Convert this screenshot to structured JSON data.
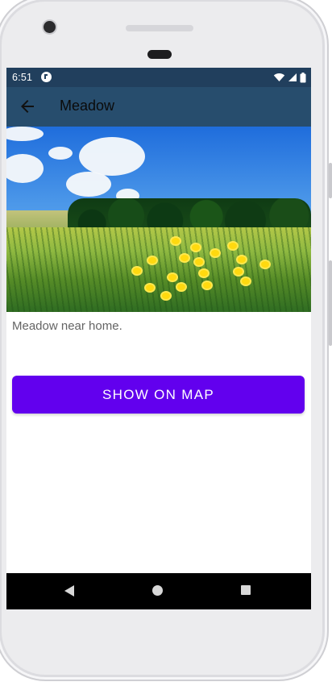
{
  "status_bar": {
    "time": "6:51",
    "app_icon": "status-app-icon",
    "icons": [
      "wifi-icon",
      "signal-icon",
      "battery-icon"
    ]
  },
  "app_bar": {
    "title": "Meadow",
    "back_icon": "arrow-back-icon"
  },
  "place": {
    "description": "Meadow near home."
  },
  "actions": {
    "show_on_map": "SHOW ON MAP"
  },
  "navigation": {
    "back_icon": "triangle-back-icon",
    "home_icon": "circle-home-icon",
    "recents_icon": "square-recents-icon"
  },
  "colors": {
    "status_bar": "#213f5d",
    "app_bar": "#274d6d",
    "primary_button": "#6200ee",
    "description_text": "#646464"
  }
}
